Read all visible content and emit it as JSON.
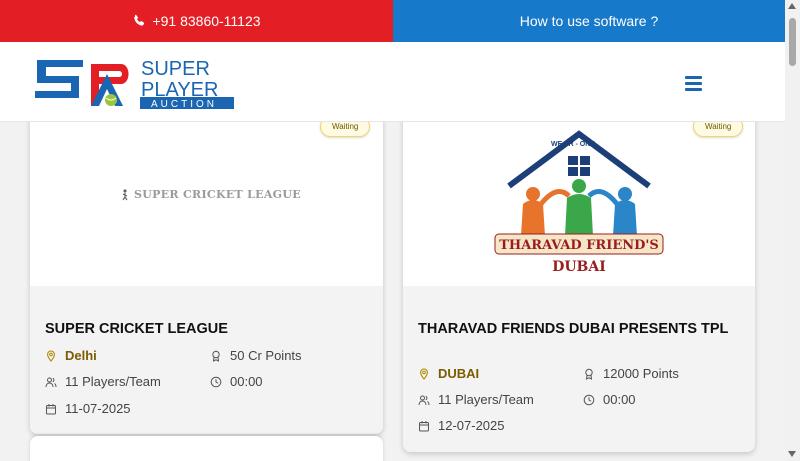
{
  "topbar": {
    "phone": "+91 83860-11123",
    "howto": "How to use software ?",
    "colors": {
      "phone_bg": "#e31e24",
      "howto_bg": "#1779c9"
    }
  },
  "header": {
    "logo": {
      "line1": "SUPER",
      "line2": "PLAYER",
      "line3": "AUCTION",
      "monogram": "SPA"
    }
  },
  "cards": [
    {
      "status": "Waiting",
      "image_text": "SUPER CRICKET LEAGUE",
      "title": "SUPER CRICKET LEAGUE",
      "location": "Delhi",
      "points": "50 Cr Points",
      "players": "11 Players/Team",
      "time": "00:00",
      "date": "11-07-2025"
    },
    {
      "status": "Waiting",
      "image_text": {
        "arc": "WE - R - ONE",
        "banner": "THARAVAD FRIEND'S",
        "city": "DUBAI"
      },
      "title": "THARAVAD FRIENDS DUBAI PRESENTS TPL",
      "location": "DUBAI",
      "points": "12000 Points",
      "players": "11 Players/Team",
      "time": "00:00",
      "date": "12-07-2025"
    }
  ]
}
